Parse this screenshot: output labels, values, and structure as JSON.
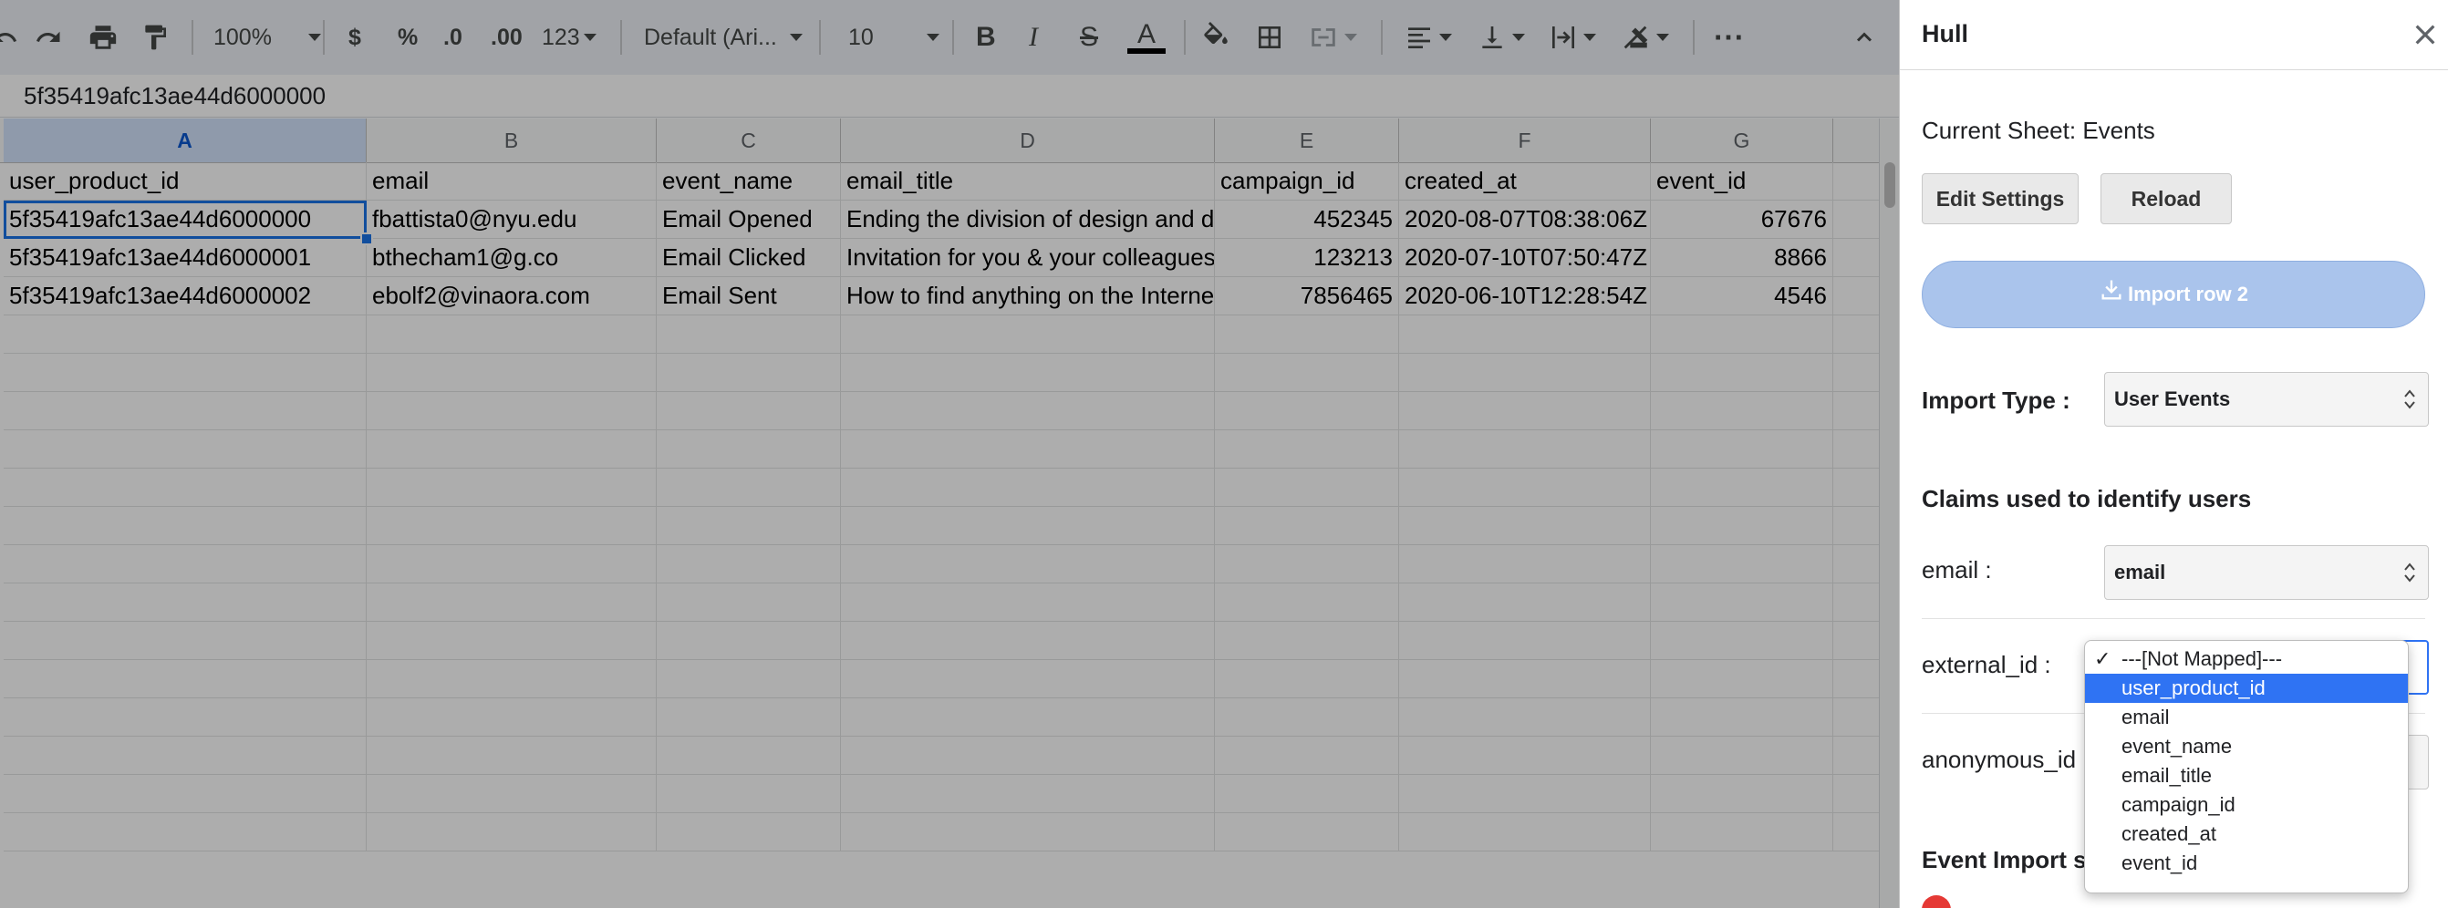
{
  "toolbar": {
    "zoom": "100%",
    "currency": "$",
    "percent": "%",
    "decrease_decimal": ".0",
    "increase_decimal": ".00",
    "more_formats": "123",
    "font": "Default (Ari...",
    "font_size": "10",
    "bold": "B",
    "italic": "I",
    "strikethrough": "S",
    "text_color": "A",
    "more": "⋯"
  },
  "formula_bar": {
    "value": "5f35419afc13ae44d6000000"
  },
  "columns": [
    "A",
    "B",
    "C",
    "D",
    "E",
    "F",
    "G"
  ],
  "rows": [
    [
      "user_product_id",
      "email",
      "event_name",
      "email_title",
      "campaign_id",
      "created_at",
      "event_id"
    ],
    [
      "5f35419afc13ae44d6000000",
      "fbattista0@nyu.edu",
      "Email Opened",
      "Ending the division of design and d",
      "452345",
      "2020-08-07T08:38:06Z",
      "67676"
    ],
    [
      "5f35419afc13ae44d6000001",
      "bthecham1@g.co",
      "Email Clicked",
      "Invitation for you & your colleagues",
      "123213",
      "2020-07-10T07:50:47Z",
      "8866"
    ],
    [
      "5f35419afc13ae44d6000002",
      "ebolf2@vinaora.com",
      "Email Sent",
      "How to find anything on the Interne",
      "7856465",
      "2020-06-10T12:28:54Z",
      "4546"
    ]
  ],
  "sidebar": {
    "title": "Hull",
    "current_sheet": "Current Sheet: Events",
    "edit_settings": "Edit Settings",
    "reload": "Reload",
    "import_row": "Import row 2",
    "import_type_label": "Import Type :",
    "import_type_value": "User Events",
    "claims_heading": "Claims used to identify users",
    "email_label": "email :",
    "email_value": "email",
    "external_id_label": "external_id :",
    "anonymous_id_label": "anonymous_id :",
    "event_import_heading": "Event Import s"
  },
  "dropdown": {
    "options": [
      "---[Not Mapped]---",
      "user_product_id",
      "email",
      "event_name",
      "email_title",
      "campaign_id",
      "created_at",
      "event_id"
    ],
    "checked": "---[Not Mapped]---",
    "highlighted": "user_product_id"
  },
  "colors": {
    "accent": "#1a73e8",
    "dropdown_highlight": "#2f73f3",
    "import_button": "#aac4ec",
    "error": "#e53935"
  }
}
